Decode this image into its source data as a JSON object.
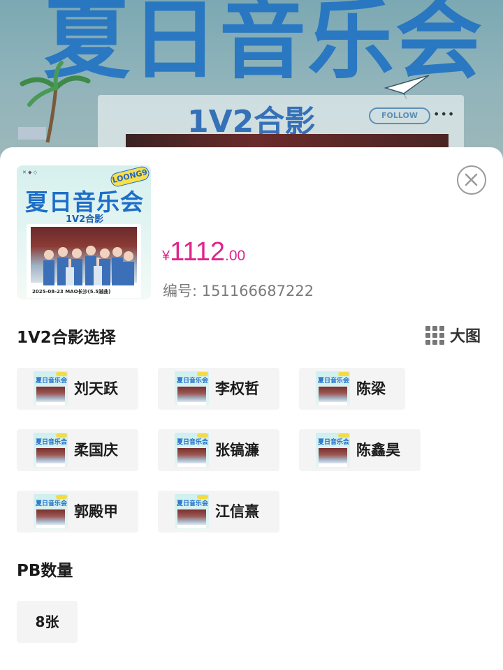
{
  "background_poster": {
    "title": "夏日音乐会",
    "subtitle": "1V2合影",
    "follow_label": "FOLLOW",
    "more_label": "•••"
  },
  "product": {
    "thumbnail": {
      "tag": "LOONG9",
      "title": "夏日音乐会",
      "subtitle": "1V2合影",
      "date_line": "2025-08-23  MAO长沙(5.5滋曲)"
    },
    "price": {
      "currency": "¥",
      "integer": "1112",
      "decimal": ".00"
    },
    "code_label": "编号:",
    "code_value": "151166687222"
  },
  "sheet": {
    "close_icon": "close-circle-icon"
  },
  "group_photo": {
    "title": "1V2合影选择",
    "big_view_label": "大图",
    "options": [
      "刘天跃",
      "李权哲",
      "陈梁",
      "柔国庆",
      "张镐濂",
      "陈鑫昊",
      "郭殿甲",
      "江信熹"
    ]
  },
  "pb": {
    "title": "PB数量",
    "options": [
      "8张"
    ]
  },
  "colors": {
    "price": "#e0248c",
    "option_bg": "#f4f4f4",
    "poster_blue": "#1e6ec8"
  }
}
